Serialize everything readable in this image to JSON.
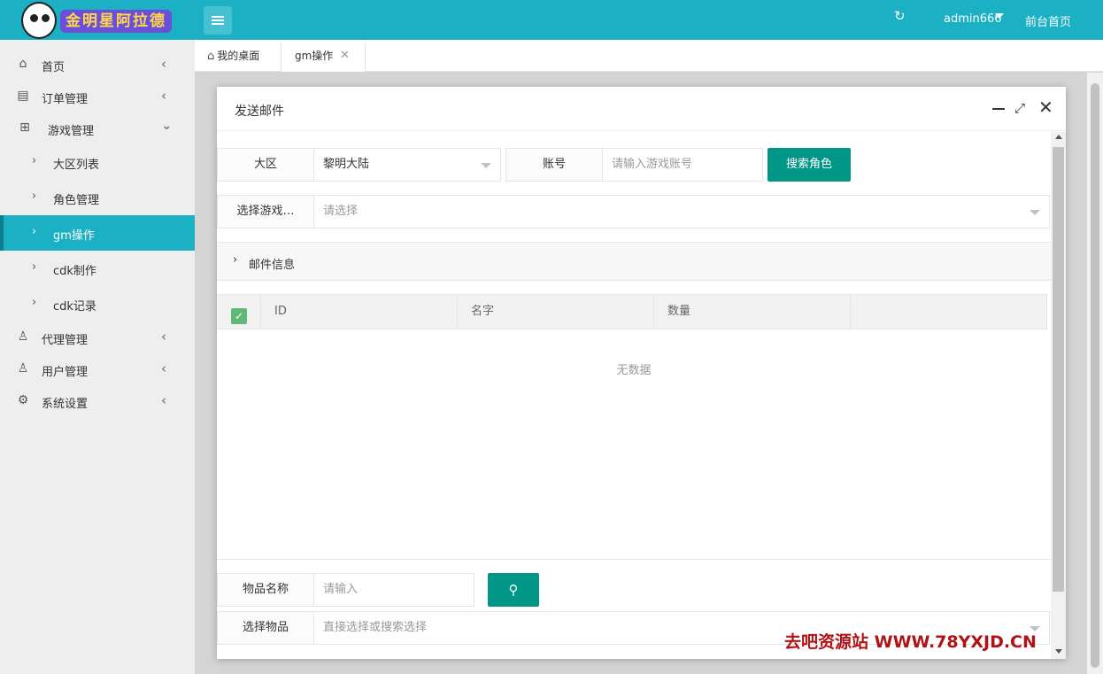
{
  "header": {
    "logo_text": "金明星阿拉德",
    "user": "admin666",
    "front_link": "前台首页",
    "refresh_icon": "refresh-icon",
    "menu_icon": "hamburger-icon"
  },
  "sidebar": {
    "items": [
      {
        "label": "首页",
        "icon": "home-icon"
      },
      {
        "label": "订单管理",
        "icon": "file-icon"
      },
      {
        "label": "游戏管理",
        "icon": "sitemap-icon"
      },
      {
        "label": "代理管理",
        "icon": "user-icon"
      },
      {
        "label": "用户管理",
        "icon": "user-icon"
      },
      {
        "label": "系统设置",
        "icon": "gear-icon"
      }
    ],
    "sub_items": [
      {
        "label": "大区列表"
      },
      {
        "label": "角色管理"
      },
      {
        "label": "gm操作",
        "active": true
      },
      {
        "label": "cdk制作"
      },
      {
        "label": "cdk记录"
      }
    ]
  },
  "tabs": {
    "home": "我的桌面",
    "current": "gm操作"
  },
  "modal": {
    "title": "发送邮件",
    "region_label": "大区",
    "region_value": "黎明大陆",
    "account_label": "账号",
    "account_placeholder": "请输入游戏账号",
    "search_role_button": "搜索角色",
    "select_game_label": "选择游戏…",
    "select_game_placeholder": "请选择",
    "mail_info_label": "邮件信息",
    "table": {
      "columns": [
        "ID",
        "名字",
        "数量"
      ],
      "empty_text": "无数据"
    },
    "item_name_label": "物品名称",
    "item_name_placeholder": "请输入",
    "select_item_label": "选择物品",
    "select_item_placeholder": "直接选择或搜索选择"
  },
  "watermark": "去吧资源站  WWW.78YXJD.CN",
  "colors": {
    "topbar": "#1bb0c4",
    "primary_button": "#009688",
    "active_nav": "#1bb0c4",
    "checkbox": "#5fb878"
  }
}
